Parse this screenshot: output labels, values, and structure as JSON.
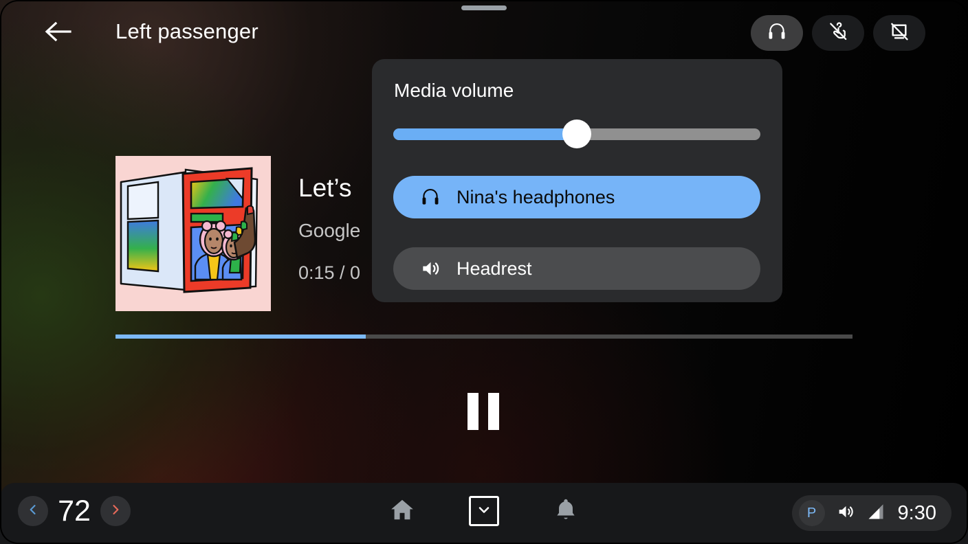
{
  "window": {
    "drag_handle": "drag-handle"
  },
  "topbar": {
    "back_icon": "arrow-back-icon",
    "title": "Left passenger",
    "actions": [
      {
        "icon": "headphones-icon",
        "name": "headphones-toggle",
        "active": true
      },
      {
        "icon": "touch-off-icon",
        "name": "touch-disabled-toggle",
        "active": false
      },
      {
        "icon": "screen-off-icon",
        "name": "screen-off-toggle",
        "active": false
      }
    ]
  },
  "player": {
    "album_art_alt": "album-artwork",
    "track_title": "Let’s",
    "artist": "Google",
    "time": "0:15 / 0",
    "progress_percent": 34,
    "transport_icon": "pause-icon",
    "transport_label": "Pause"
  },
  "volume_panel": {
    "title": "Media volume",
    "slider": {
      "name": "media-volume-slider",
      "value_percent": 50
    },
    "devices": [
      {
        "label": "Nina's headphones",
        "icon": "headphones-icon",
        "selected": true
      },
      {
        "label": "Headrest",
        "icon": "speaker-icon",
        "selected": false
      }
    ]
  },
  "bottombar": {
    "temperature": {
      "decrease_icon": "chevron-left-icon",
      "value": "72",
      "increase_icon": "chevron-right-icon"
    },
    "nav": [
      {
        "icon": "home-icon",
        "name": "nav-home"
      },
      {
        "icon": "chevron-down-icon",
        "name": "nav-collapse"
      },
      {
        "icon": "bell-icon",
        "name": "nav-notifications"
      }
    ],
    "status": {
      "gear_label": "P",
      "volume_icon": "volume-icon",
      "signal_icon": "signal-icon",
      "clock": "9:30"
    }
  },
  "colors": {
    "accent_blue": "#6aaef5",
    "progress_blue": "#7cb9f7",
    "panel_bg": "#2a2b2d",
    "bottom_bg": "#17181a",
    "decrease_blue": "#5b9bd5",
    "increase_red": "#e86a5a"
  }
}
